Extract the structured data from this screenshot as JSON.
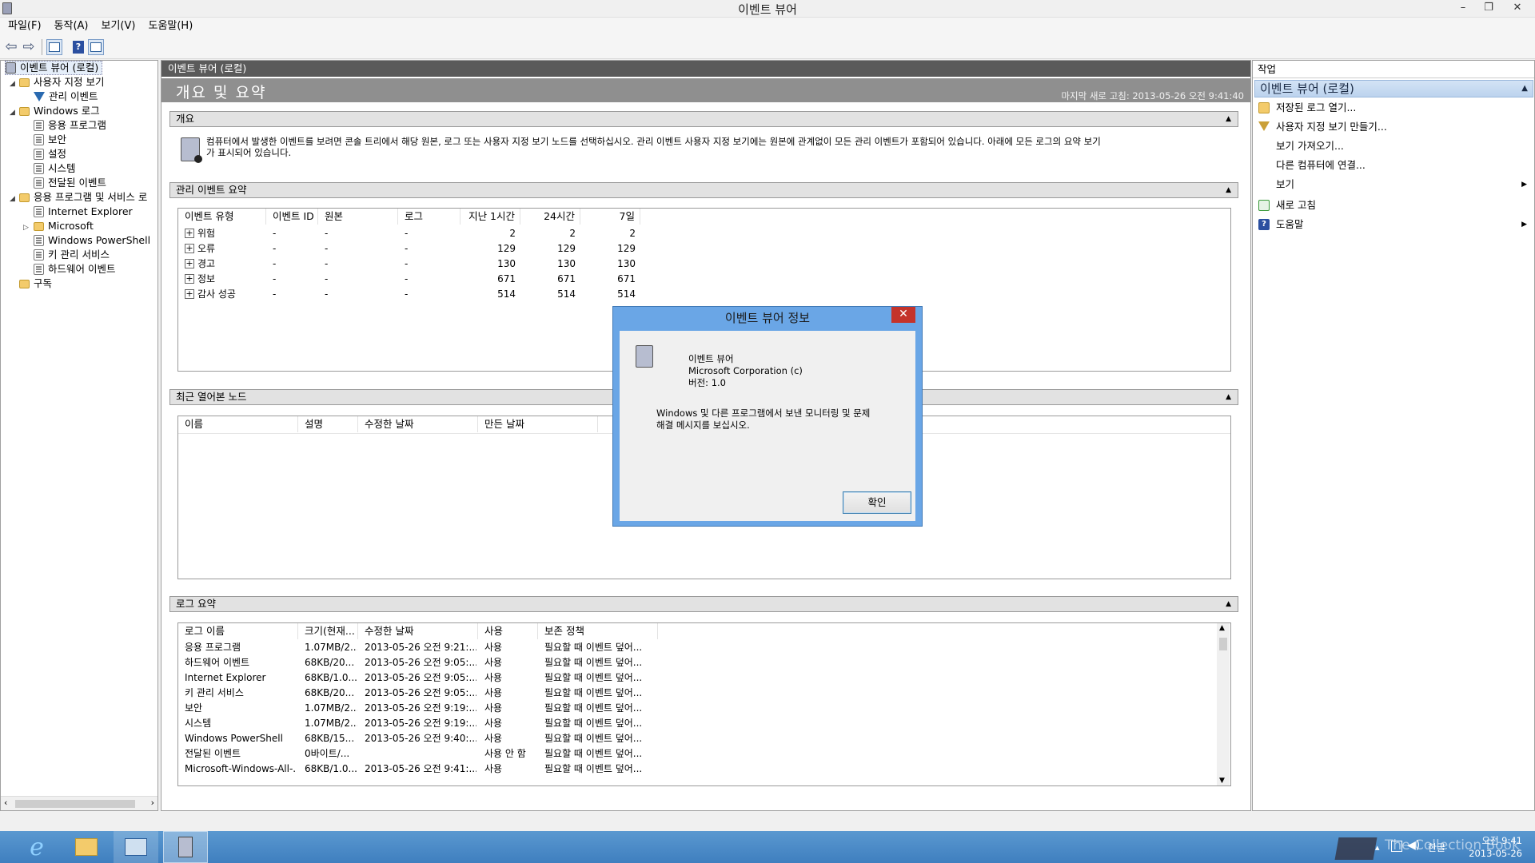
{
  "window": {
    "title": "이벤트 뷰어"
  },
  "menu": [
    "파일(F)",
    "동작(A)",
    "보기(V)",
    "도움말(H)"
  ],
  "tree": {
    "root": "이벤트 뷰어 (로컬)",
    "custom_views": "사용자 지정 보기",
    "admin_events": "관리 이벤트",
    "windows_logs": "Windows 로그",
    "app": "응용 프로그램",
    "security": "보안",
    "setup": "설정",
    "system": "시스템",
    "forwarded": "전달된 이벤트",
    "apps_services": "응용 프로그램 및 서비스 로",
    "ie": "Internet Explorer",
    "microsoft": "Microsoft",
    "powershell": "Windows PowerShell",
    "key_mgmt": "키 관리 서비스",
    "hardware": "하드웨어 이벤트",
    "subscriptions": "구독"
  },
  "center": {
    "header": "이벤트 뷰어 (로컬)",
    "title": "개요 및 요약",
    "refreshed": "마지막 새로 고침: 2013-05-26 오전 9:41:40",
    "overview": {
      "label": "개요",
      "text1": "컴퓨터에서 발생한 이벤트를 보려면 콘솔 트리에서 해당 원본, 로그 또는 사용자 지정 보기 노드를 선택하십시오. 관리 이벤트 사용자 지정 보기에는 원본에 관계없이 모든 관리 이벤트가 포함되어 있습니다. 아래에 모든 로그의 요약 보기",
      "text2": "가 표시되어 있습니다."
    },
    "admin_summary": {
      "label": "관리 이벤트 요약",
      "columns": [
        "이벤트 유형",
        "이벤트 ID",
        "원본",
        "로그",
        "지난 1시간",
        "24시간",
        "7일"
      ],
      "rows": [
        {
          "type": "위험",
          "id": "-",
          "src": "-",
          "log": "-",
          "h1": "2",
          "h24": "2",
          "d7": "2"
        },
        {
          "type": "오류",
          "id": "-",
          "src": "-",
          "log": "-",
          "h1": "129",
          "h24": "129",
          "d7": "129"
        },
        {
          "type": "경고",
          "id": "-",
          "src": "-",
          "log": "-",
          "h1": "130",
          "h24": "130",
          "d7": "130"
        },
        {
          "type": "정보",
          "id": "-",
          "src": "-",
          "log": "-",
          "h1": "671",
          "h24": "671",
          "d7": "671"
        },
        {
          "type": "감사 성공",
          "id": "-",
          "src": "-",
          "log": "-",
          "h1": "514",
          "h24": "514",
          "d7": "514"
        }
      ]
    },
    "recent": {
      "label": "최근 열어본 노드",
      "columns": [
        "이름",
        "설명",
        "수정한 날짜",
        "만든 날짜"
      ]
    },
    "log_summary": {
      "label": "로그 요약",
      "columns": [
        "로그 이름",
        "크기(현재...",
        "수정한 날짜",
        "사용",
        "보존 정책"
      ],
      "rows": [
        {
          "name": "응용 프로그램",
          "size": "1.07MB/2...",
          "date": "2013-05-26 오전 9:21:...",
          "use": "사용",
          "policy": "필요할 때 이벤트 덮어..."
        },
        {
          "name": "하드웨어 이벤트",
          "size": "68KB/20...",
          "date": "2013-05-26 오전 9:05:...",
          "use": "사용",
          "policy": "필요할 때 이벤트 덮어..."
        },
        {
          "name": "Internet Explorer",
          "size": "68KB/1.0...",
          "date": "2013-05-26 오전 9:05:...",
          "use": "사용",
          "policy": "필요할 때 이벤트 덮어..."
        },
        {
          "name": "키 관리 서비스",
          "size": "68KB/20...",
          "date": "2013-05-26 오전 9:05:...",
          "use": "사용",
          "policy": "필요할 때 이벤트 덮어..."
        },
        {
          "name": "보안",
          "size": "1.07MB/2...",
          "date": "2013-05-26 오전 9:19:...",
          "use": "사용",
          "policy": "필요할 때 이벤트 덮어..."
        },
        {
          "name": "시스템",
          "size": "1.07MB/2...",
          "date": "2013-05-26 오전 9:19:...",
          "use": "사용",
          "policy": "필요할 때 이벤트 덮어..."
        },
        {
          "name": "Windows PowerShell",
          "size": "68KB/15...",
          "date": "2013-05-26 오전 9:40:...",
          "use": "사용",
          "policy": "필요할 때 이벤트 덮어..."
        },
        {
          "name": "전달된 이벤트",
          "size": "0바이트/...",
          "date": "",
          "use": "사용 안 함",
          "policy": "필요할 때 이벤트 덮어..."
        },
        {
          "name": "Microsoft-Windows-All-...",
          "size": "68KB/1.0...",
          "date": "2013-05-26 오전 9:41:...",
          "use": "사용",
          "policy": "필요할 때 이벤트 덮어..."
        }
      ]
    }
  },
  "actions": {
    "header": "작업",
    "selected": "이벤트 뷰어 (로컬)",
    "items": [
      "저장된 로그 열기...",
      "사용자 지정 보기 만들기...",
      "보기 가져오기...",
      "다른 컴퓨터에 연결...",
      "보기",
      "새로 고침",
      "도움말"
    ]
  },
  "dialog": {
    "title": "이벤트 뷰어 정보",
    "product": "이벤트 뷰어",
    "company": "Microsoft Corporation (c)",
    "version": "버전: 1.0",
    "desc1": "Windows 및 다른 프로그램에서 보낸 모니터링 및 문제",
    "desc2": "해결 메시지를 보십시오.",
    "ok": "확인"
  },
  "tray": {
    "ime": "한글",
    "time": "오전 9:41",
    "date": "2013-05-26",
    "watermark": "The Collection Book"
  },
  "colors": {
    "taskbar": "#4a8ccb",
    "dialog_frame": "#6aa6e6",
    "close": "#c4332b",
    "header_dark": "#5a5a5a"
  }
}
